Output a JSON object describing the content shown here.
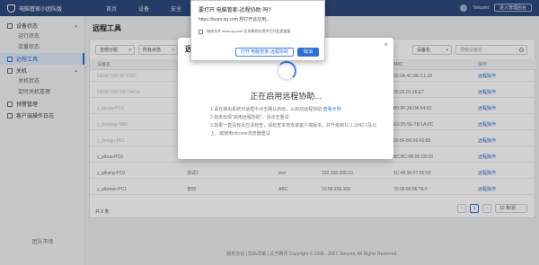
{
  "app": {
    "title": "电脑管家小团队版"
  },
  "topnav": [
    "首页",
    "设备",
    "安全"
  ],
  "user": {
    "name": "Tencent",
    "manage_label": "进入管理后台"
  },
  "sidebar": {
    "groups": [
      {
        "label": "设备状态",
        "items": [
          "运行状态",
          "流量状态"
        ]
      },
      {
        "label": "远程工具",
        "items": []
      },
      {
        "label": "关机",
        "items": [
          "关机状态",
          "定时关机管理"
        ]
      },
      {
        "label": "预警管理",
        "items": []
      },
      {
        "label": "客户端操作日志",
        "items": []
      }
    ],
    "bottom_label": "团队市场"
  },
  "page": {
    "title": "远程工具",
    "filters": [
      "全部分组",
      "所有状态"
    ],
    "right_filter": "设备名",
    "search_placeholder": "搜索设备名"
  },
  "table": {
    "headers": [
      "设备名",
      "用户",
      "备注",
      "IP",
      "MAC",
      "操作"
    ],
    "rows": [
      {
        "name": "DESKTOP-8PY5B2",
        "user": "",
        "note": "",
        "ip": "",
        "mac": "50:9A:4C:8E:C1:18",
        "op": "远程操作",
        "blurred": true
      },
      {
        "name": "DESKTOP-PRTN41A",
        "user": "",
        "note": "",
        "ip": "",
        "mac": "30:26:01:16:E7",
        "op": "远程操作",
        "blurred": true
      },
      {
        "name": "y_lacota-PC0",
        "user": "",
        "note": "",
        "ip": "",
        "mac": "B0:9F:3A:0A:64:03",
        "op": "远程操作",
        "blurred": true
      },
      {
        "name": "y_desktop-N80",
        "user": "",
        "note": "",
        "ip": "",
        "mac": "E0:D5:5E:7B:1A:0C",
        "op": "远程操作",
        "blurred": true
      },
      {
        "name": "y_design-P81",
        "user": "",
        "note": "",
        "ip": "",
        "mac": "30:8F:B6:06:F0:85",
        "op": "远程操作",
        "blurred": true
      },
      {
        "name": "y_pibuo-PC0",
        "user": "测试2",
        "note": "test",
        "ip": "192.168.255.10",
        "mac": "BC:8C:4B:06:C8:18",
        "op": "远程操作",
        "blurred": false
      },
      {
        "name": "y_piliang-PC0",
        "user": "测试2",
        "note": "test",
        "ip": "192.168.255.10",
        "mac": "6C:48:90:07:5E:59",
        "op": "远程操作",
        "blurred": false
      },
      {
        "name": "y_pibman-PC1",
        "user": "李四",
        "note": "ABC",
        "ip": "10.58.226.106",
        "mac": "70:28:96:06:7E:F",
        "op": "远程操作",
        "blurred": false
      }
    ],
    "total": "共 8 条",
    "current_page": "1",
    "page_size": "10 条/页"
  },
  "footer": "服务协议 | 隐私政策 | 关于腾讯 Copyright © 1998 - 2021 Tencent. All Rights Reserved.",
  "modal": {
    "title": "远程",
    "connecting": "正在启用远程协助...",
    "step1": "1.请在弹出系统对话框中点击确认启动，以启动远程协助",
    "step1_link": "查看示例",
    "step2": "2.如未出现“启用远程协助”，请点击重试",
    "step2_link": "点击重试",
    "step3": "3.如果一直没有反应请检查，请检查本地安装客户端版本，并升级到11.1.1042.1及以上，或使用chrome浏览器重试"
  },
  "prompt": {
    "title": "要打开 电脑管家-远程协助 吗?",
    "text": "https://team.qq.com 想打开此应用。",
    "checkbox": "始终允许 team.qq.com 在关联的应用中打开此类链接",
    "open_label": "打开 电脑管家-远程协助",
    "cancel_label": "取消"
  }
}
